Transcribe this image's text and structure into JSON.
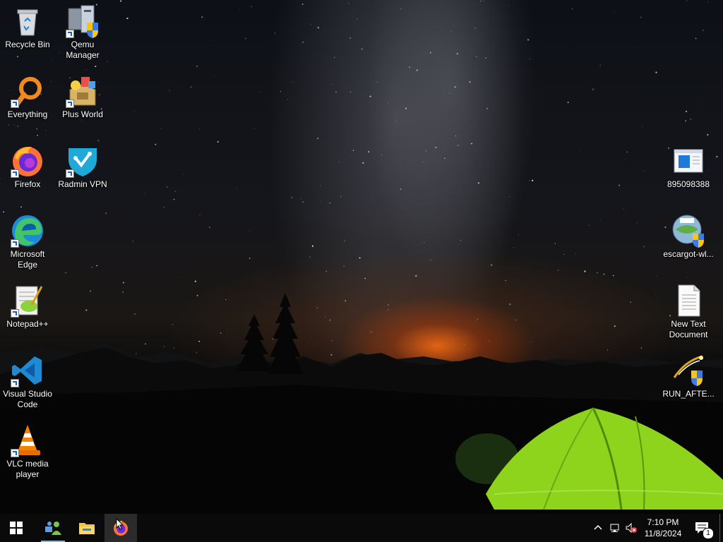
{
  "desktop": {
    "icons_left": [
      {
        "id": "recycle-bin",
        "label": "Recycle Bin",
        "icon": "recycle-bin-icon",
        "shortcut": false
      },
      {
        "id": "qemu-manager",
        "label": "Qemu Manager",
        "icon": "qemu-manager-icon",
        "shortcut": true
      },
      {
        "id": "everything",
        "label": "Everything",
        "icon": "everything-search-icon",
        "shortcut": true
      },
      {
        "id": "plus-world",
        "label": "Plus World",
        "icon": "plus-world-icon",
        "shortcut": true
      },
      {
        "id": "firefox",
        "label": "Firefox",
        "icon": "firefox-icon",
        "shortcut": true
      },
      {
        "id": "radmin-vpn",
        "label": "Radmin VPN",
        "icon": "radmin-vpn-icon",
        "shortcut": true
      },
      {
        "id": "microsoft-edge",
        "label": "Microsoft Edge",
        "icon": "edge-icon",
        "shortcut": true
      },
      {
        "id": "notepad-plus-plus",
        "label": "Notepad++",
        "icon": "notepad-plus-plus-icon",
        "shortcut": true
      },
      {
        "id": "visual-studio-code",
        "label": "Visual Studio Code",
        "icon": "vscode-icon",
        "shortcut": true
      },
      {
        "id": "vlc",
        "label": "VLC media player",
        "icon": "vlc-icon",
        "shortcut": true
      }
    ],
    "icons_right": [
      {
        "id": "file-895098388",
        "label": "895098388",
        "icon": "document-window-icon"
      },
      {
        "id": "escargot",
        "label": "escargot-wl...",
        "icon": "escargot-installer-icon"
      },
      {
        "id": "new-text-document",
        "label": "New Text Document",
        "icon": "text-document-icon"
      },
      {
        "id": "run-after",
        "label": "RUN_AFTE...",
        "icon": "run-after-script-icon"
      }
    ]
  },
  "taskbar": {
    "start": "start-button-windows-icon",
    "pinned": [
      {
        "id": "network-people",
        "icon": "network-users-icon",
        "running": true
      },
      {
        "id": "file-explorer",
        "icon": "file-explorer-icon",
        "running": false
      },
      {
        "id": "firefox-app",
        "icon": "firefox-taskbar-icon",
        "running": false,
        "hovered": true
      }
    ],
    "tray": {
      "overflow": "chevron-up-icon",
      "network": "network-icon",
      "volume": "volume-muted-icon"
    },
    "clock": {
      "time": "7:10 PM",
      "date": "11/8/2024"
    },
    "notifications": {
      "icon": "action-center-icon",
      "count": "1"
    }
  },
  "colors": {
    "taskbar_bg": "#0a0a0a",
    "accent": "#76b9ed",
    "tent": "#8fd41c"
  }
}
